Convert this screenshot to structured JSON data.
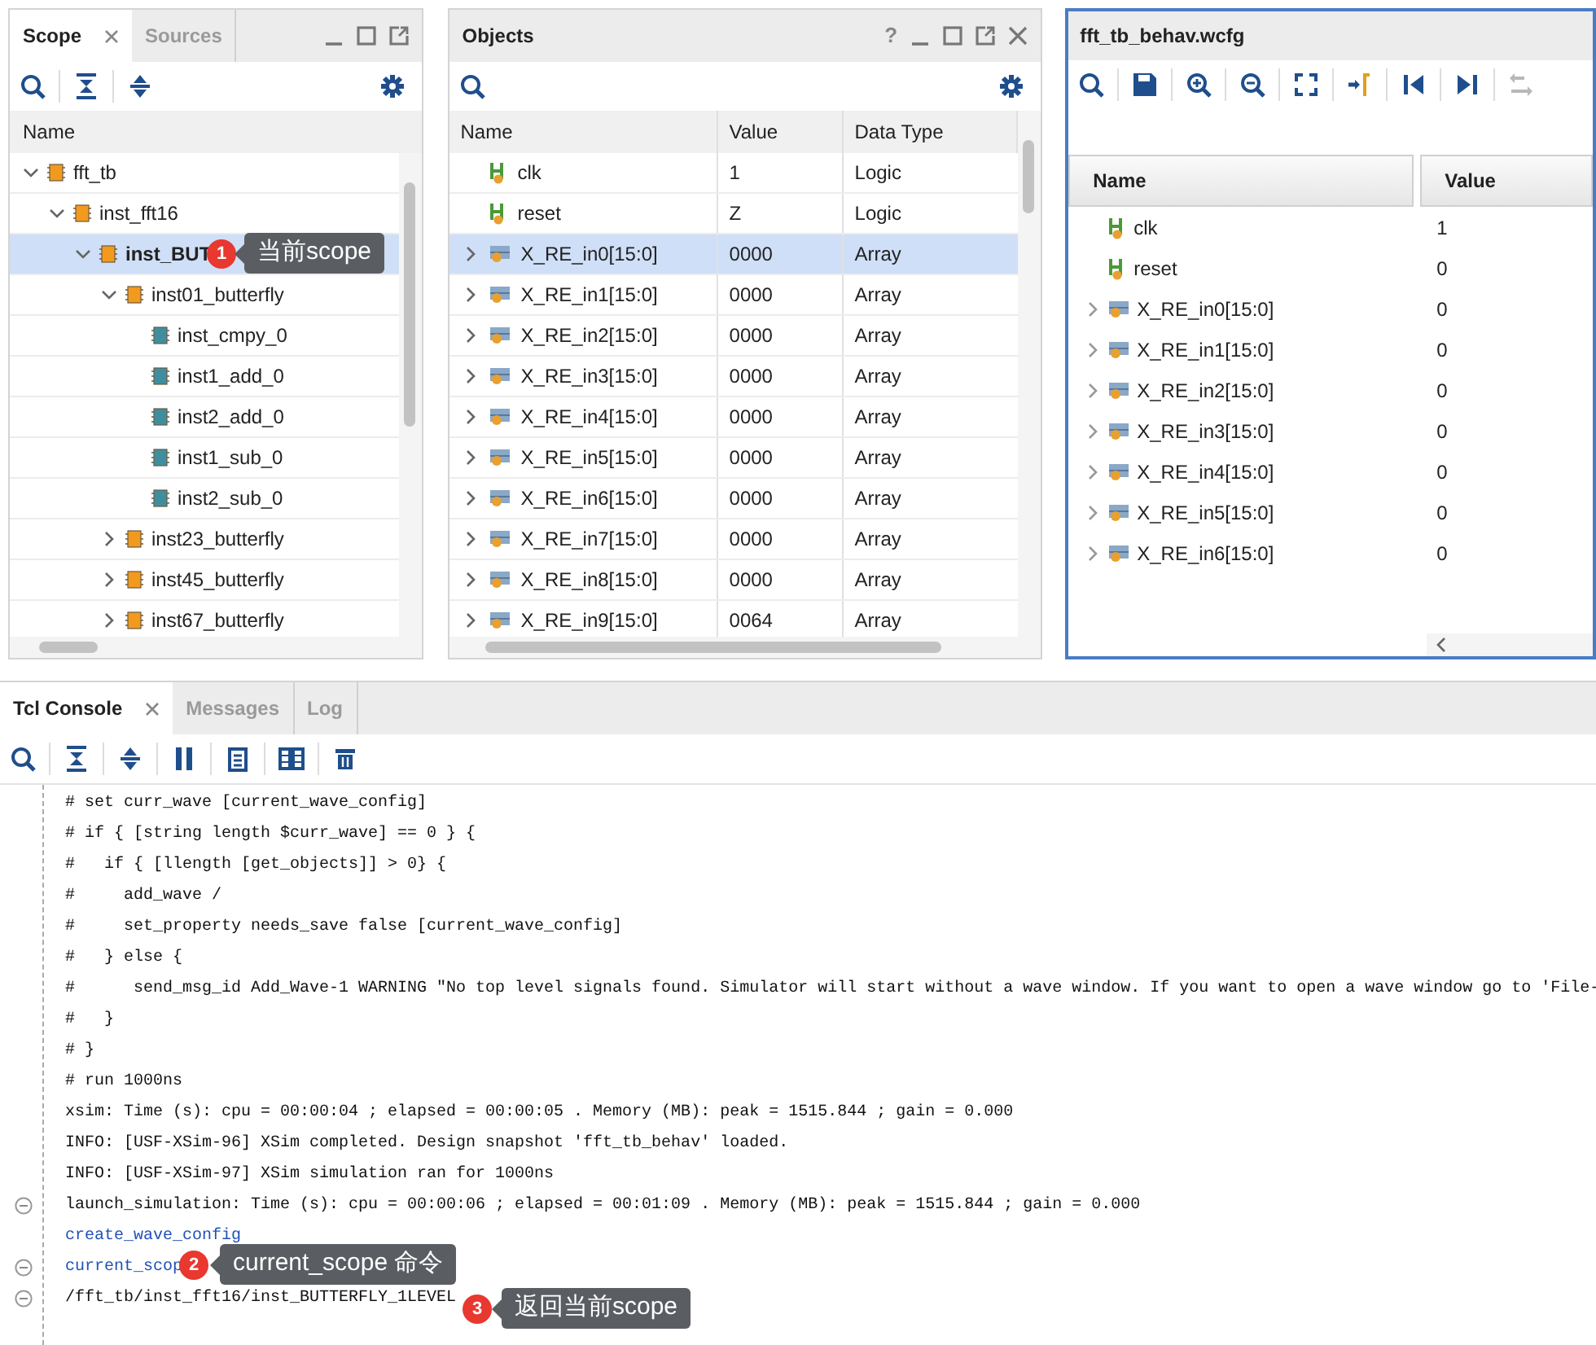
{
  "scope_panel": {
    "tabs": [
      {
        "label": "Scope",
        "selected": true,
        "closable": true
      },
      {
        "label": "Sources",
        "selected": false,
        "closable": false
      }
    ],
    "column": "Name",
    "tree": [
      {
        "label": "fft_tb",
        "kind": "module",
        "expanded": true,
        "selected": false,
        "children": [
          {
            "label": "inst_fft16",
            "kind": "module",
            "expanded": true,
            "selected": false,
            "children": [
              {
                "label": "inst_BUT",
                "kind": "module",
                "expanded": true,
                "selected": true,
                "children": [
                  {
                    "label": "inst01_butterfly",
                    "kind": "module",
                    "expanded": true,
                    "selected": false,
                    "children": [
                      {
                        "label": "inst_cmpy_0",
                        "kind": "leaf",
                        "selected": false
                      },
                      {
                        "label": "inst1_add_0",
                        "kind": "leaf",
                        "selected": false
                      },
                      {
                        "label": "inst2_add_0",
                        "kind": "leaf",
                        "selected": false
                      },
                      {
                        "label": "inst1_sub_0",
                        "kind": "leaf",
                        "selected": false
                      },
                      {
                        "label": "inst2_sub_0",
                        "kind": "leaf",
                        "selected": false
                      }
                    ]
                  },
                  {
                    "label": "inst23_butterfly",
                    "kind": "module",
                    "expanded": false,
                    "selected": false
                  },
                  {
                    "label": "inst45_butterfly",
                    "kind": "module",
                    "expanded": false,
                    "selected": false
                  },
                  {
                    "label": "inst67_butterfly",
                    "kind": "module",
                    "expanded": false,
                    "selected": false
                  }
                ]
              }
            ]
          }
        ]
      }
    ]
  },
  "objects_panel": {
    "title": "Objects",
    "help": "?",
    "columns": [
      "Name",
      "Value",
      "Data Type"
    ],
    "rows": [
      {
        "name": "clk",
        "value": "1",
        "type": "Logic",
        "kind": "logic",
        "selected": false
      },
      {
        "name": "reset",
        "value": "Z",
        "type": "Logic",
        "kind": "logic",
        "selected": false
      },
      {
        "name": "X_RE_in0[15:0]",
        "value": "0000",
        "type": "Array",
        "kind": "array",
        "selected": true
      },
      {
        "name": "X_RE_in1[15:0]",
        "value": "0000",
        "type": "Array",
        "kind": "array",
        "selected": false
      },
      {
        "name": "X_RE_in2[15:0]",
        "value": "0000",
        "type": "Array",
        "kind": "array",
        "selected": false
      },
      {
        "name": "X_RE_in3[15:0]",
        "value": "0000",
        "type": "Array",
        "kind": "array",
        "selected": false
      },
      {
        "name": "X_RE_in4[15:0]",
        "value": "0000",
        "type": "Array",
        "kind": "array",
        "selected": false
      },
      {
        "name": "X_RE_in5[15:0]",
        "value": "0000",
        "type": "Array",
        "kind": "array",
        "selected": false
      },
      {
        "name": "X_RE_in6[15:0]",
        "value": "0000",
        "type": "Array",
        "kind": "array",
        "selected": false
      },
      {
        "name": "X_RE_in7[15:0]",
        "value": "0000",
        "type": "Array",
        "kind": "array",
        "selected": false
      },
      {
        "name": "X_RE_in8[15:0]",
        "value": "0000",
        "type": "Array",
        "kind": "array",
        "selected": false
      },
      {
        "name": "X_RE_in9[15:0]",
        "value": "0064",
        "type": "Array",
        "kind": "array",
        "selected": false
      }
    ]
  },
  "wave_panel": {
    "title": "fft_tb_behav.wcfg",
    "columns": [
      "Name",
      "Value"
    ],
    "rows": [
      {
        "name": "clk",
        "value": "1",
        "kind": "logic"
      },
      {
        "name": "reset",
        "value": "0",
        "kind": "logic"
      },
      {
        "name": "X_RE_in0[15:0]",
        "value": "0",
        "kind": "array"
      },
      {
        "name": "X_RE_in1[15:0]",
        "value": "0",
        "kind": "array"
      },
      {
        "name": "X_RE_in2[15:0]",
        "value": "0",
        "kind": "array"
      },
      {
        "name": "X_RE_in3[15:0]",
        "value": "0",
        "kind": "array"
      },
      {
        "name": "X_RE_in4[15:0]",
        "value": "0",
        "kind": "array"
      },
      {
        "name": "X_RE_in5[15:0]",
        "value": "0",
        "kind": "array"
      },
      {
        "name": "X_RE_in6[15:0]",
        "value": "0",
        "kind": "array"
      }
    ]
  },
  "console": {
    "tabs": [
      {
        "label": "Tcl Console",
        "selected": true,
        "closable": true
      },
      {
        "label": "Messages",
        "selected": false,
        "closable": false
      },
      {
        "label": "Log",
        "selected": false,
        "closable": false
      }
    ],
    "lines": [
      {
        "text": "# set curr_wave [current_wave_config]",
        "kind": "output",
        "fold": false
      },
      {
        "text": "# if { [string length $curr_wave] == 0 } {",
        "kind": "output",
        "fold": false
      },
      {
        "text": "#   if { [llength [get_objects]] > 0} {",
        "kind": "output",
        "fold": false
      },
      {
        "text": "#     add_wave /",
        "kind": "output",
        "fold": false
      },
      {
        "text": "#     set_property needs_save false [current_wave_config]",
        "kind": "output",
        "fold": false
      },
      {
        "text": "#   } else {",
        "kind": "output",
        "fold": false
      },
      {
        "text": "#      send_msg_id Add_Wave-1 WARNING \"No top level signals found. Simulator will start without a wave window. If you want to open a wave window go to 'File-",
        "kind": "output",
        "fold": false
      },
      {
        "text": "#   }",
        "kind": "output",
        "fold": false
      },
      {
        "text": "# }",
        "kind": "output",
        "fold": false
      },
      {
        "text": "# run 1000ns",
        "kind": "output",
        "fold": false
      },
      {
        "text": "xsim: Time (s): cpu = 00:00:04 ; elapsed = 00:00:05 . Memory (MB): peak = 1515.844 ; gain = 0.000",
        "kind": "output",
        "fold": false
      },
      {
        "text": "INFO: [USF-XSim-96] XSim completed. Design snapshot 'fft_tb_behav' loaded.",
        "kind": "output",
        "fold": false
      },
      {
        "text": "INFO: [USF-XSim-97] XSim simulation ran for 1000ns",
        "kind": "output",
        "fold": false
      },
      {
        "text": "launch_simulation: Time (s): cpu = 00:00:06 ; elapsed = 00:01:09 . Memory (MB): peak = 1515.844 ; gain = 0.000",
        "kind": "output",
        "fold": true
      },
      {
        "text": "create_wave_config",
        "kind": "command",
        "fold": false
      },
      {
        "text": "current_scop",
        "kind": "command",
        "fold": true
      },
      {
        "text": "/fft_tb/inst_fft16/inst_BUTTERFLY_1LEVEL",
        "kind": "output",
        "fold": true
      }
    ]
  },
  "callouts": [
    {
      "number": "1",
      "text": "当前scope"
    },
    {
      "number": "2",
      "text": "current_scope 命令"
    },
    {
      "number": "3",
      "text": "返回当前scope"
    }
  ]
}
